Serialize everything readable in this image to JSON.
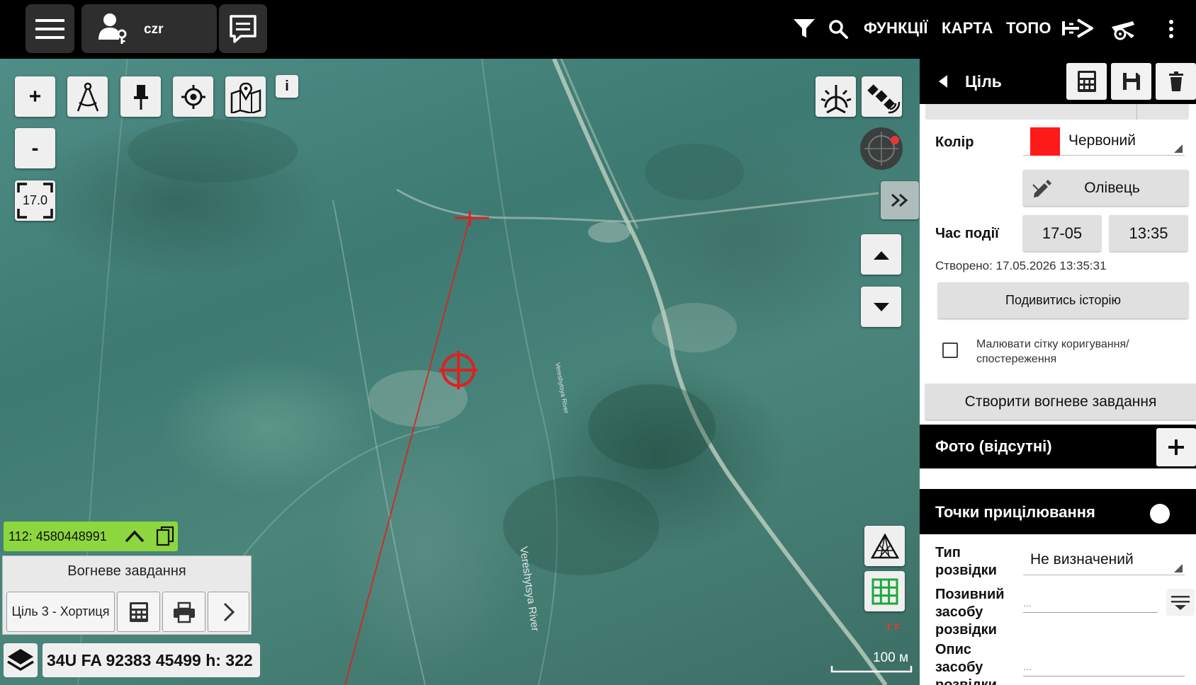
{
  "topbar": {
    "user_label": "czr",
    "functions_label": "ФУНКЦІЇ",
    "map_label": "КАРТА",
    "topo_label": "ТОПО"
  },
  "map": {
    "zoom_in_label": "+",
    "zoom_out_label": "-",
    "zoom_level": "17.0",
    "info_label": "i",
    "scale_label": "100 м",
    "tf_label": "T F",
    "river_label": "Vereshytsya River",
    "river_label_small": "Vereshytsya River",
    "coord_id": "112: 4580448991",
    "fire_task_title": "Вогневе завдання",
    "target_name": "Ціль 3 - Хортиця",
    "mgrs": "34U FA 92383 45499 h: 322"
  },
  "panel": {
    "title": "Ціль",
    "color_label": "Колір",
    "color_value": "Червоний",
    "color_hex": "#ff1a1a",
    "pencil_label": "Олівець",
    "event_time_label": "Час події",
    "event_date": "17-05",
    "event_time": "13:35",
    "created_text": "Створено: 17.05.2026 13:35:31",
    "history_button": "Подивитись історію",
    "grid_checkbox_label": "Малювати сітку коригування/ спостереження",
    "create_fire_task_button": "Створити вогневе завдання",
    "photo_section": "Фото (відсутні)",
    "aim_points_section": "Точки прицілювання",
    "recon_type_label": "Тип розвідки",
    "recon_type_value": "Не визначений",
    "recon_callsign_label": "Позивний засобу розвідки",
    "recon_callsign_placeholder": "...",
    "recon_desc_label": "Опис засобу розвідки",
    "recon_desc_placeholder": "..."
  }
}
